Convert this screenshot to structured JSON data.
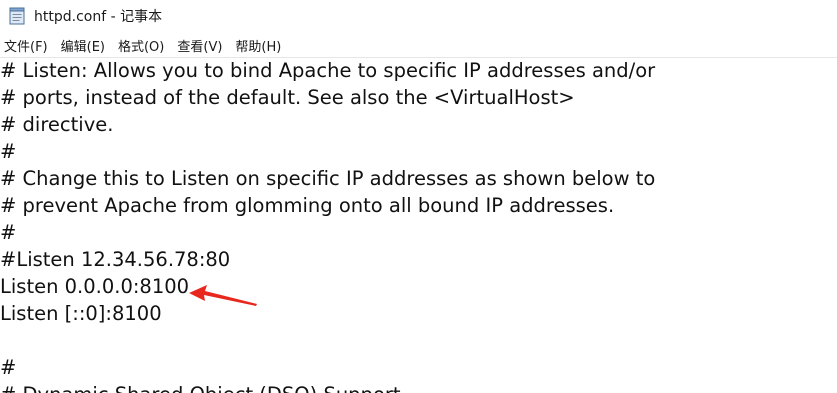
{
  "window": {
    "title": "httpd.conf - 记事本",
    "icon": "notepad-icon"
  },
  "menubar": {
    "items": [
      "文件(F)",
      "编辑(E)",
      "格式(O)",
      "查看(V)",
      "帮助(H)"
    ]
  },
  "editor": {
    "lines": [
      "# Listen: Allows you to bind Apache to specific IP addresses and/or",
      "# ports, instead of the default. See also the <VirtualHost>",
      "# directive.",
      "#",
      "# Change this to Listen on specific IP addresses as shown below to",
      "# prevent Apache from glomming onto all bound IP addresses.",
      "#",
      "#Listen 12.34.56.78:80",
      "Listen 0.0.0.0:8100",
      "Listen [::0]:8100",
      "",
      "#",
      "# Dynamic Shared Object (DSO) Support"
    ]
  },
  "annotation": {
    "arrow_color": "#e8281e"
  }
}
